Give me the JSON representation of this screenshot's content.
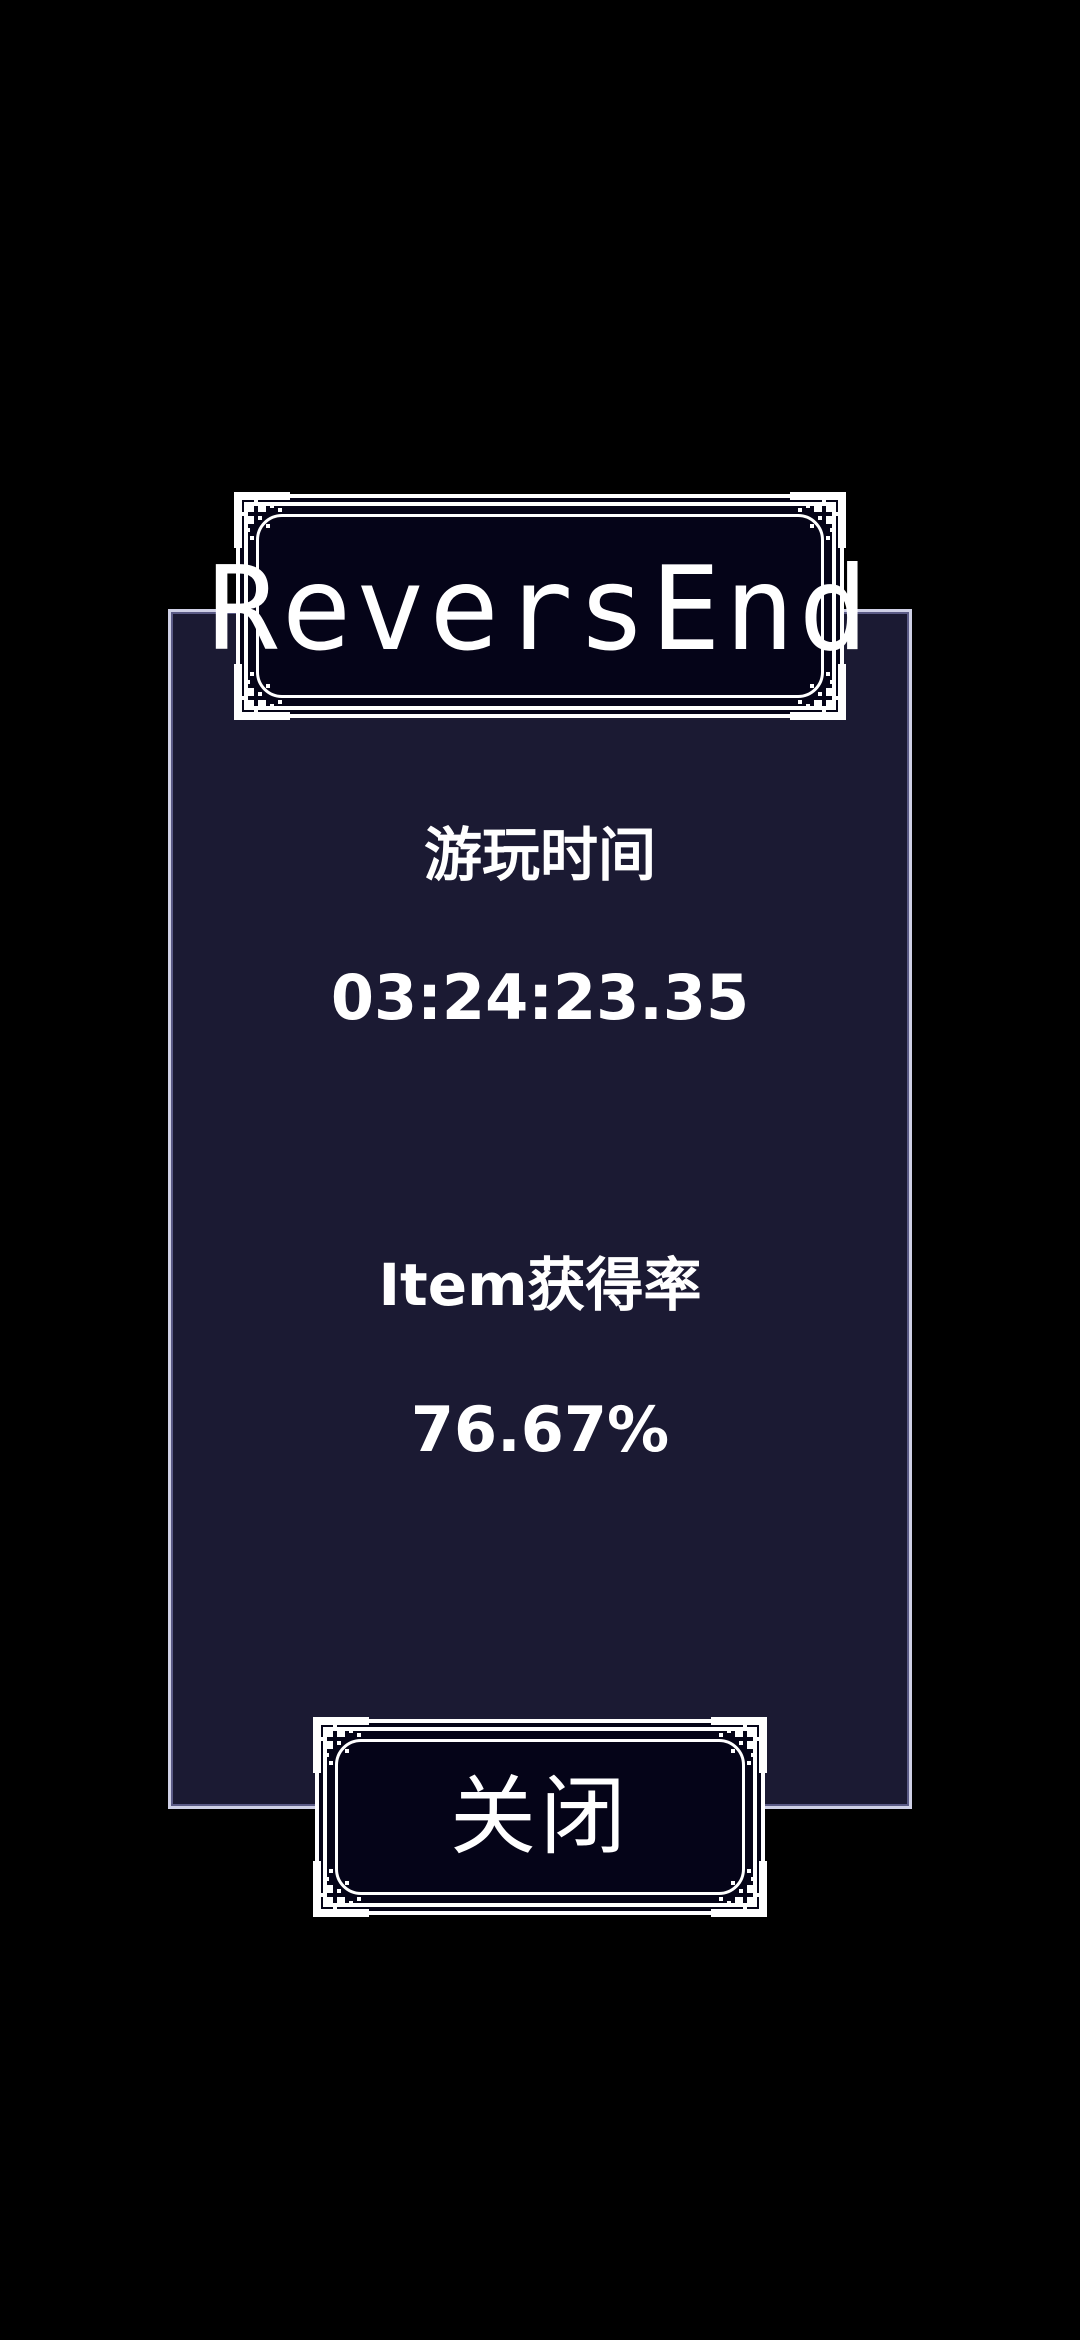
{
  "game": {
    "title": "ReversEnd"
  },
  "stats": {
    "play_time_label": "游玩时间",
    "play_time_value": "03:24:23.35",
    "item_rate_label": "Item获得率",
    "item_rate_value": "76.67%"
  },
  "actions": {
    "close_label": "关闭"
  },
  "colors": {
    "background": "#000000",
    "panel": "#1b1a33",
    "frame": "#050418",
    "border": "#ffffff"
  }
}
